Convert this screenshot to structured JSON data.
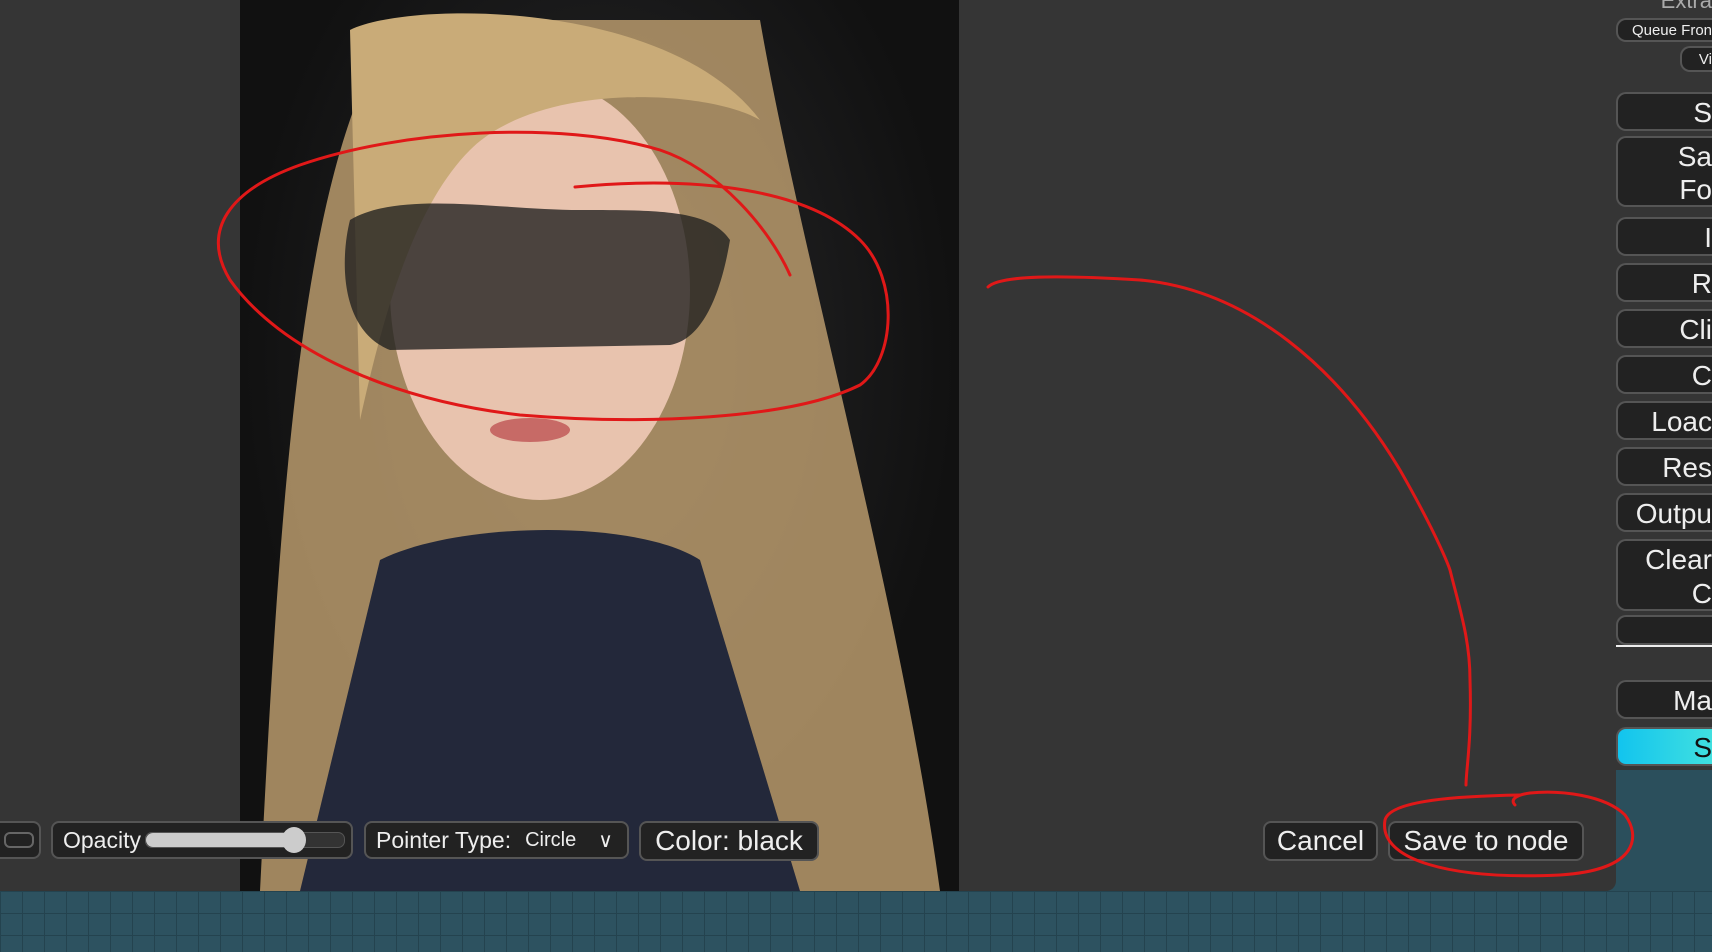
{
  "toolbar": {
    "opacity_label": "Opacity",
    "opacity_value": 0.75,
    "pointer_label": "Pointer Type:",
    "pointer_value": "Circle",
    "color_label": "Color: black",
    "cancel_label": "Cancel",
    "save_label": "Save to node"
  },
  "panel": {
    "header": "Extra",
    "queue_front": "Queue Fron",
    "view": "Vi",
    "items": [
      "S",
      "Sa\nFo",
      "I",
      "R",
      "Cli",
      "C",
      "Loac",
      "Res",
      "Outpu",
      "Clear\nC",
      "",
      "Ma",
      "S"
    ]
  },
  "colors": {
    "annotation": "#e01818",
    "accent": "#19c8e8",
    "grid": "#2b4f5c"
  }
}
